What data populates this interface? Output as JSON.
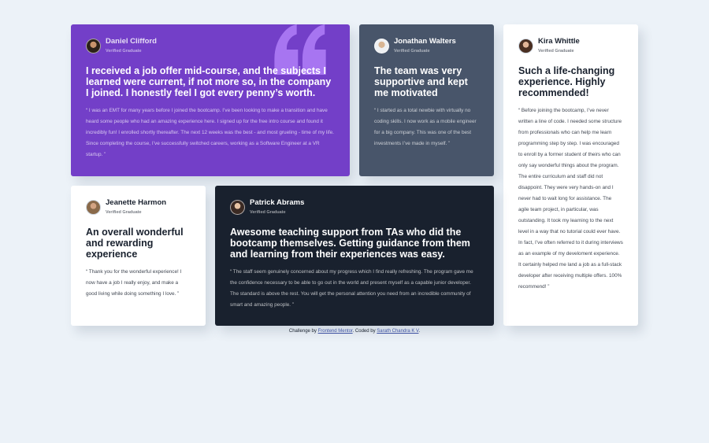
{
  "colors": {
    "page_bg": "#ecf2f8",
    "purple": "#733fc8",
    "grayish_blue": "#48556a",
    "dark_blue": "#19212e",
    "white": "#ffffff",
    "quote_mark": "#a775f1"
  },
  "testimonials": [
    {
      "name": "Daniel Clifford",
      "tag": "Verified Graduate",
      "avatar_icon": "avatar-daniel",
      "heading": "I received a job offer mid-course, and the subjects I learned were current, if not more so, in the company I joined. I honestly feel I got every penny’s worth.",
      "quote": "“ I was an EMT for many years before I joined the bootcamp. I’ve been looking to make a transition and have heard some people who had an amazing experience here. I signed up for the free intro course and found it incredibly fun! I enrolled shortly thereafter. The next 12 weeks was the best - and most grueling - time of my life. Since completing the course, I’ve successfully switched careers, working as a Software Engineer at a VR startup. ”"
    },
    {
      "name": "Jonathan Walters",
      "tag": "Verified Graduate",
      "avatar_icon": "avatar-jonathan",
      "heading": "The team was very supportive and kept me motivated",
      "quote": "“ I started as a total newbie with virtually no coding skills. I now work as a mobile engineer for a big company. This was one of the best investments I’ve made in myself. ”"
    },
    {
      "name": "Kira Whittle",
      "tag": "Verified Graduate",
      "avatar_icon": "avatar-kira",
      "heading": "Such a life-changing experience. Highly recommended!",
      "quote": "“ Before joining the bootcamp, I’ve never written a line of code. I needed some structure from professionals who can help me learn programming step by step. I was encouraged to enroll by a former student of theirs who can only say wonderful things about the program. The entire curriculum and staff did not disappoint. They were very hands-on and I never had to wait long for assistance. The agile team project, in particular, was outstanding. It took my learning to the next level in a way that no tutorial could ever have. In fact, I’ve often referred to it during interviews as an example of my develoment experience. It certainly helped me land a job as a full-stack developer after receiving multiple offers. 100% recommend! ”"
    },
    {
      "name": "Jeanette Harmon",
      "tag": "Verified Graduate",
      "avatar_icon": "avatar-jeanette",
      "heading": "An overall wonderful and rewarding experience",
      "quote": "“ Thank you for the wonderful experience! I now have a job I really enjoy, and make a good living while doing something I love. ”"
    },
    {
      "name": "Patrick Abrams",
      "tag": "Verified Graduate",
      "avatar_icon": "avatar-patrick",
      "heading": "Awesome teaching support from TAs who did the bootcamp themselves. Getting guidance from them and learning from their experiences was easy.",
      "quote": "“ The staff seem genuinely concerned about my progress which I find really refreshing. The program gave me the confidence necessary to be able to go out in the world and present myself as a capable junior developer. The standard is above the rest. You will get the personal attention you need from an incredible community of smart and amazing people. ”"
    }
  ],
  "decoration": {
    "quote_mark_icon": "quotation-mark-icon"
  },
  "attribution": {
    "prefix": "Challenge by",
    "link1": "Frontend Mentor",
    "middle": ". Coded by",
    "link2": "Sarath Chandra K V",
    "suffix": "."
  }
}
